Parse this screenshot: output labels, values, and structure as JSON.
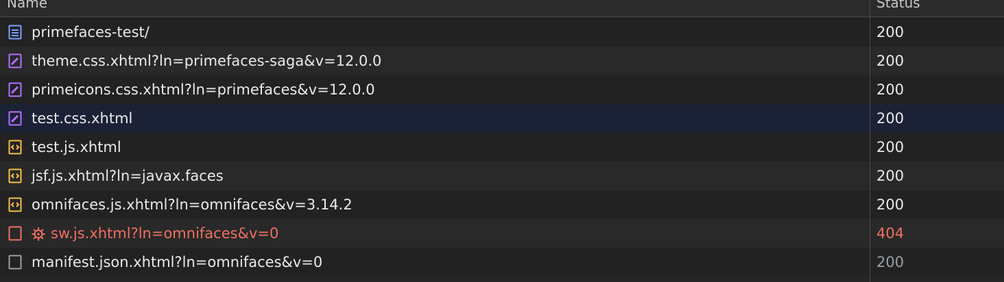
{
  "columns": {
    "name": "Name",
    "status": "Status"
  },
  "requests": [
    {
      "name": "primefaces-test/",
      "status": "200",
      "type": "document",
      "icon": "document-icon"
    },
    {
      "name": "theme.css.xhtml?ln=primefaces-saga&v=12.0.0",
      "status": "200",
      "type": "stylesheet",
      "icon": "stylesheet-icon"
    },
    {
      "name": "primeicons.css.xhtml?ln=primefaces&v=12.0.0",
      "status": "200",
      "type": "stylesheet",
      "icon": "stylesheet-icon"
    },
    {
      "name": "test.css.xhtml",
      "status": "200",
      "type": "stylesheet",
      "icon": "stylesheet-icon",
      "selected": true
    },
    {
      "name": "test.js.xhtml",
      "status": "200",
      "type": "script",
      "icon": "script-icon"
    },
    {
      "name": "jsf.js.xhtml?ln=javax.faces",
      "status": "200",
      "type": "script",
      "icon": "script-icon"
    },
    {
      "name": "omnifaces.js.xhtml?ln=omnifaces&v=3.14.2",
      "status": "200",
      "type": "script",
      "icon": "script-icon"
    },
    {
      "name": "sw.js.xhtml?ln=omnifaces&v=0",
      "status": "404",
      "type": "error",
      "icon": "error-file-icon",
      "secondary_icon": "gear-icon"
    },
    {
      "name": "manifest.json.xhtml?ln=omnifaces&v=0",
      "status": "200",
      "type": "other",
      "icon": "generic-file-icon"
    }
  ],
  "colors": {
    "background": "#262626",
    "selected_row": "#1c2235",
    "document_icon": "#7aa2ff",
    "stylesheet_icon": "#b470ff",
    "script_icon": "#f6c343",
    "error": "#f16f62",
    "muted": "#9aa0a6"
  }
}
